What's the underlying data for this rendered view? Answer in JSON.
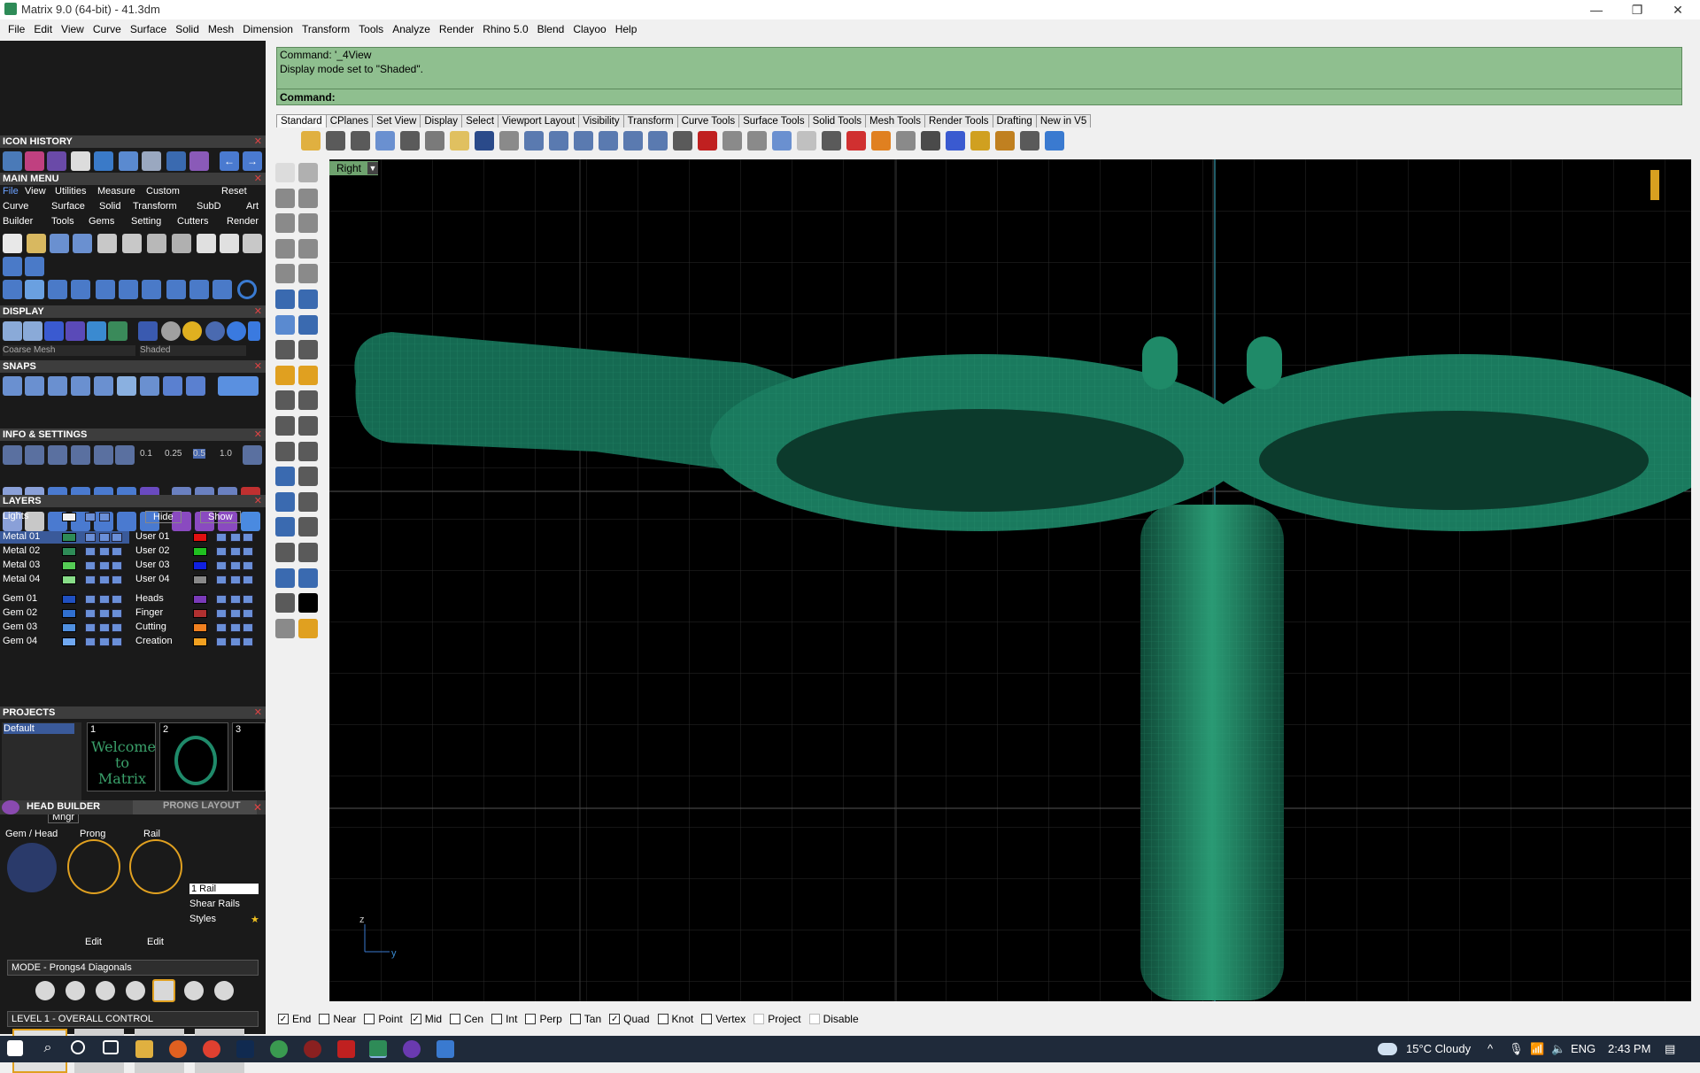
{
  "window": {
    "title": "Matrix 9.0 (64-bit) - 41.3dm",
    "minimize": "—",
    "restore": "❐",
    "close": "✕"
  },
  "menubar": [
    "File",
    "Edit",
    "View",
    "Curve",
    "Surface",
    "Solid",
    "Mesh",
    "Dimension",
    "Transform",
    "Tools",
    "Analyze",
    "Render",
    "Rhino 5.0",
    "Blend",
    "Clayoo",
    "Help"
  ],
  "command": {
    "history_line1": "Command: '_4View",
    "history_line2": "Display mode set to \"Shaded\".",
    "prompt": "Command:"
  },
  "tabs": [
    "Standard",
    "CPlanes",
    "Set View",
    "Display",
    "Select",
    "Viewport Layout",
    "Visibility",
    "Transform",
    "Curve Tools",
    "Surface Tools",
    "Solid Tools",
    "Mesh Tools",
    "Render Tools",
    "Drafting",
    "New in V5"
  ],
  "viewport": {
    "name": "Right",
    "axis_z": "z",
    "axis_y": "y"
  },
  "left_panel": {
    "icon_history": "ICON HISTORY",
    "main_menu": "MAIN MENU",
    "main_menu_tabs": [
      "File",
      "View",
      "Utilities",
      "Measure",
      "Custom",
      "Reset"
    ],
    "main_menu_row1": [
      "Curve",
      "Surface",
      "Solid",
      "Transform",
      "SubD",
      "Art"
    ],
    "main_menu_row2": [
      "Builder",
      "Tools",
      "Gems",
      "Setting",
      "Cutters",
      "Render"
    ],
    "display": "DISPLAY",
    "display_mesh": "Coarse Mesh",
    "display_mode": "Shaded",
    "snaps": "SNAPS",
    "snap_values": [
      "0.1",
      "0.25",
      "0.5",
      "1.0"
    ],
    "info_settings": "INFO & SETTINGS",
    "layers": "LAYERS",
    "layers_lights": "Lights",
    "layers_hide": "Hide",
    "layers_show": "Show",
    "layers_left": [
      "Metal 01",
      "Metal 02",
      "Metal 03",
      "Metal 04",
      "Gem 01",
      "Gem 02",
      "Gem 03",
      "Gem 04"
    ],
    "layers_right": [
      "User 01",
      "User 02",
      "User 03",
      "User 04",
      "Heads",
      "Finger",
      "Cutting",
      "Creation"
    ],
    "layers_right_colors": [
      "#e01010",
      "#20c020",
      "#1020e0",
      "#888888",
      "#7a3ab8",
      "#b03030",
      "#f08020",
      "#f0a020"
    ],
    "layers_left_colors": [
      "#2e8b57",
      "#2e8b57",
      "#55cc55",
      "#88dd88",
      "#2050c0",
      "#3070d0",
      "#5090e0",
      "#70a8f0"
    ],
    "projects": "PROJECTS",
    "projects_default": "Default",
    "project_thumbs": [
      "1",
      "2",
      "3"
    ],
    "project_welcome": "Welcome to Matrix",
    "projects_mngr": "Mngr",
    "head_builder": "HEAD  BUILDER",
    "prong_layout": "PRONG LAYOUT",
    "gem_head": "Gem / Head",
    "prong": "Prong",
    "rail": "Rail",
    "edit1": "Edit",
    "edit2": "Edit",
    "rail_count": "1 Rail",
    "shear_rails": "Shear Rails",
    "styles": "Styles",
    "mode": "MODE - Prongs4 Diagonals",
    "level": "LEVEL 1 - OVERALL CONTROL"
  },
  "osnaps": [
    {
      "label": "End",
      "checked": true
    },
    {
      "label": "Near",
      "checked": false
    },
    {
      "label": "Point",
      "checked": false
    },
    {
      "label": "Mid",
      "checked": true
    },
    {
      "label": "Cen",
      "checked": false
    },
    {
      "label": "Int",
      "checked": false
    },
    {
      "label": "Perp",
      "checked": false
    },
    {
      "label": "Tan",
      "checked": false
    },
    {
      "label": "Quad",
      "checked": true
    },
    {
      "label": "Knot",
      "checked": false
    },
    {
      "label": "Vertex",
      "checked": false
    },
    {
      "label": "Project",
      "checked": false
    },
    {
      "label": "Disable",
      "checked": false
    }
  ],
  "taskbar": {
    "weather": "15°C  Cloudy",
    "language": "ENG",
    "time": "2:43 PM"
  },
  "colors": {
    "command_bg": "#8fbf8f",
    "model_green": "#1f7a5c",
    "viewport_bg": "#000000"
  }
}
